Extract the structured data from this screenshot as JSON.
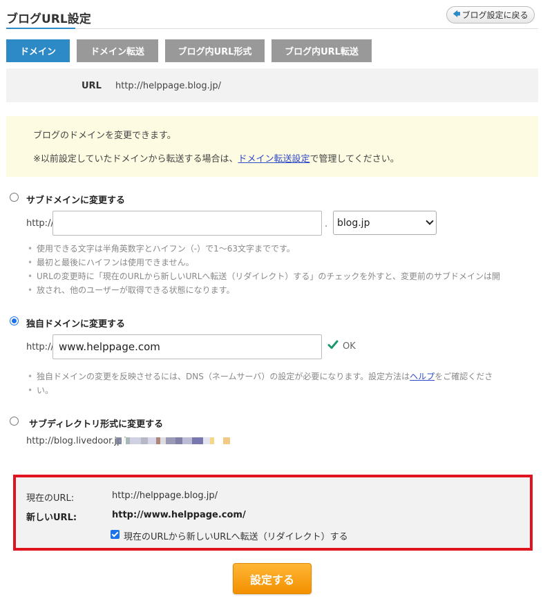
{
  "page_title": "ブログURL設定",
  "back_button": {
    "label": "ブログ設定に戻る",
    "icon": "back-arrow-icon"
  },
  "tabs": [
    {
      "label": "ドメイン",
      "active": true
    },
    {
      "label": "ドメイン転送",
      "active": false
    },
    {
      "label": "ブログ内URL形式",
      "active": false
    },
    {
      "label": "ブログ内URL転送",
      "active": false
    }
  ],
  "url_panel": {
    "label": "URL",
    "value": "http://helppage.blog.jp/"
  },
  "notice": {
    "line1": "ブログのドメインを変更できます。",
    "line2_before": "※以前設定していたドメインから転送する場合は、",
    "line2_link": "ドメイン転送設定",
    "line2_after": "で管理してください。"
  },
  "subdomain": {
    "label": "サブドメインに変更する",
    "checked": false,
    "prefix": "http://",
    "input_value": "",
    "dot": ".",
    "select_value": "blog.jp",
    "hints": [
      "使用できる文字は半角英数字とハイフン（-）で1〜63文字までです。",
      "最初と最後にハイフンは使用できません。",
      "URLの変更時に「現在のURLから新しいURLへ転送（リダイレクト）する」のチェックを外すと、変更前のサブドメインは開",
      "放され、他のユーザーが取得できる状態になります。"
    ]
  },
  "custom_domain": {
    "label": "独自ドメインに変更する",
    "checked": true,
    "prefix": "http://",
    "input_value": "www.helppage.com",
    "ok_text": "OK",
    "ok_color": "#1a9a6a",
    "hint_before": "独自ドメインの変更を反映させるには、DNS（ネームサーバ）の設定が必要になります。設定方法は",
    "hint_link": "ヘルプ",
    "hint_after": "をご確認くださ",
    "hint_line2": "い。"
  },
  "subdirectory": {
    "label": "サブディレクトリ形式に変更する",
    "checked": false,
    "url": "http://blog.livedoor.jp/"
  },
  "summary": {
    "current_label": "現在のURL:",
    "current_value": "http://helppage.blog.jp/",
    "new_label": "新しいURL:",
    "new_value": "http://www.helppage.com/",
    "redirect_label": "現在のURLから新しいURLへ転送（リダイレクト）する",
    "redirect_checked": true,
    "border_color": "#e0141e"
  },
  "submit_button": {
    "label": "設定する",
    "color": "#f39000"
  },
  "colors": {
    "accent": "#2d8ac7",
    "tab_inactive": "#999999",
    "link": "#2d48c8"
  }
}
